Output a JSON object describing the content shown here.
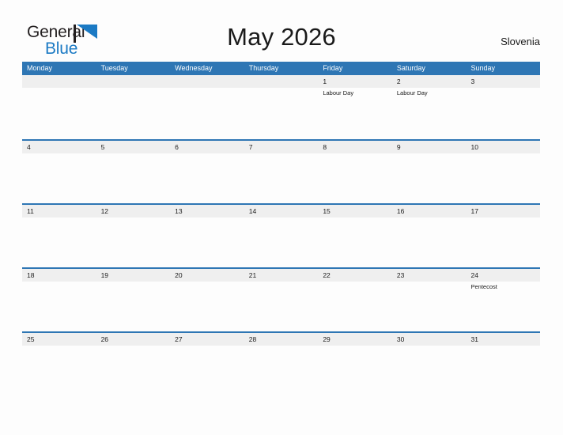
{
  "header": {
    "logo": {
      "text_primary": "General",
      "text_secondary": "Blue",
      "mark_icon": "blue-triangle-flag-icon",
      "mark_color": "#1b7ac4"
    },
    "title": "May 2026",
    "country": "Slovenia"
  },
  "colors": {
    "header_blue": "#2e76b4",
    "date_band_gray": "#efefef",
    "logo_blue": "#1b7ac4",
    "page_background": "#fdfdfd",
    "text": "#1a1a1a"
  },
  "calendar": {
    "month": "May",
    "year": "2026",
    "weekday_headers": [
      "Monday",
      "Tuesday",
      "Wednesday",
      "Thursday",
      "Friday",
      "Saturday",
      "Sunday"
    ],
    "weeks": [
      {
        "days": [
          {
            "num": "",
            "events": []
          },
          {
            "num": "",
            "events": []
          },
          {
            "num": "",
            "events": []
          },
          {
            "num": "",
            "events": []
          },
          {
            "num": "1",
            "events": [
              "Labour Day"
            ]
          },
          {
            "num": "2",
            "events": [
              "Labour Day"
            ]
          },
          {
            "num": "3",
            "events": []
          }
        ]
      },
      {
        "days": [
          {
            "num": "4",
            "events": []
          },
          {
            "num": "5",
            "events": []
          },
          {
            "num": "6",
            "events": []
          },
          {
            "num": "7",
            "events": []
          },
          {
            "num": "8",
            "events": []
          },
          {
            "num": "9",
            "events": []
          },
          {
            "num": "10",
            "events": []
          }
        ]
      },
      {
        "days": [
          {
            "num": "11",
            "events": []
          },
          {
            "num": "12",
            "events": []
          },
          {
            "num": "13",
            "events": []
          },
          {
            "num": "14",
            "events": []
          },
          {
            "num": "15",
            "events": []
          },
          {
            "num": "16",
            "events": []
          },
          {
            "num": "17",
            "events": []
          }
        ]
      },
      {
        "days": [
          {
            "num": "18",
            "events": []
          },
          {
            "num": "19",
            "events": []
          },
          {
            "num": "20",
            "events": []
          },
          {
            "num": "21",
            "events": []
          },
          {
            "num": "22",
            "events": []
          },
          {
            "num": "23",
            "events": []
          },
          {
            "num": "24",
            "events": [
              "Pentecost"
            ]
          }
        ]
      },
      {
        "days": [
          {
            "num": "25",
            "events": []
          },
          {
            "num": "26",
            "events": []
          },
          {
            "num": "27",
            "events": []
          },
          {
            "num": "28",
            "events": []
          },
          {
            "num": "29",
            "events": []
          },
          {
            "num": "30",
            "events": []
          },
          {
            "num": "31",
            "events": []
          }
        ]
      }
    ]
  }
}
